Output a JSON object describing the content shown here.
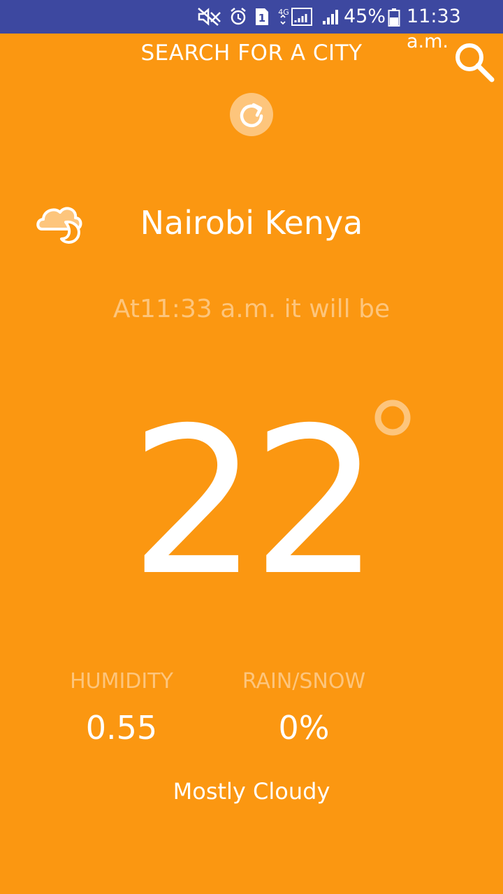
{
  "status_bar": {
    "battery": "45%",
    "time": "11:33 a.m.",
    "sim_slot": "1",
    "network": "4G",
    "icons": [
      "mute-icon",
      "alarm-icon",
      "sim-icon",
      "signal-4g-icon",
      "signal-icon",
      "battery-icon"
    ]
  },
  "header": {
    "search_title": "SEARCH FOR A CITY",
    "search_icon": "search-icon",
    "refresh_icon": "refresh-icon"
  },
  "weather": {
    "city": "Nairobi Kenya",
    "condition_icon": "partly-cloudy-night-icon",
    "time_line": "At11:33 a.m. it will be",
    "temperature": "22",
    "humidity_label": "HUMIDITY",
    "humidity_value": "0.55",
    "precip_label": "RAIN/SNOW",
    "precip_value": "0%",
    "summary": "Mostly Cloudy"
  },
  "colors": {
    "background": "#fb9711",
    "status_bar": "#3d48a0",
    "muted_text": "#fdc57c",
    "text": "#ffffff"
  }
}
